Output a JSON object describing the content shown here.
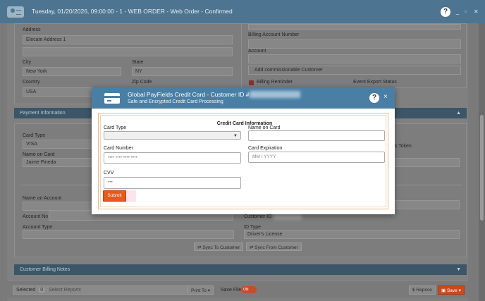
{
  "window": {
    "title": "Tuesday, 01/20/2026, 09:00:00 - 1 - WEB ORDER - Web Order - Confirmed",
    "help_glyph": "?",
    "minimize": "_",
    "maximize": "▫",
    "close": "✕"
  },
  "address_section": {
    "address_label": "Address",
    "address_value": "Elecate Address 1",
    "city_label": "City",
    "city_value": "New York",
    "state_label": "State",
    "state_value": "NY",
    "country_label": "Country",
    "country_value": "USA",
    "zip_label": "Zip Code"
  },
  "billing_section": {
    "billing_account_label": "Billing Account Number",
    "account_label": "Account",
    "commissionable_placeholder": "Add commissionable Customer",
    "billing_reminder_label": "Billing Reminder",
    "event_export_label": "Event Export Status"
  },
  "payment_section": {
    "header": "Payment Information",
    "card_type_label": "Card Type",
    "card_type_value": "VISA",
    "name_on_card_label": "Name on Card",
    "name_on_card_value": "Jaime Pineda",
    "token_text": "d Is Token",
    "name_on_account_label": "Name on Account",
    "account_no_label": "Account No",
    "account_type_label": "Account Type",
    "customer_id_label": "Customer ID",
    "id_type_label": "ID Type",
    "id_type_value": "Driver's License",
    "sync_to_label": "Sync To Customer",
    "sync_from_label": "Sync From Customer"
  },
  "customer_billing_notes": {
    "header": "Customer Billing Notes"
  },
  "bottom_bar": {
    "selected_label": "Selected",
    "selected_count": "0",
    "select_reports_placeholder": "Select Reports",
    "print_to_label": "Print To",
    "save_file_label": "Save File",
    "save_file_toggle": "ON",
    "reprice_label": "Reprice",
    "save_label": "Save"
  },
  "modal": {
    "title": "Global PayFields Credit Card - Customer ID #:",
    "subtitle": "Safe and Encrypted Credit Card Processing",
    "help_glyph": "?",
    "close_glyph": "×",
    "form_title": "Credit Card Information",
    "card_type_label": "Card Type",
    "card_type_value": "",
    "name_on_card_label": "Name on Card",
    "card_number_label": "Card Number",
    "card_number_placeholder": "•••• •••• •••• ••••",
    "card_expiration_label": "Card Expiration",
    "card_expiration_placeholder": "MM / YYYY",
    "cvv_label": "CVV",
    "cvv_placeholder": "•••",
    "submit_label": "Submit"
  },
  "colors": {
    "titlebar": "#4d7591",
    "modal_header": "#4a7fa5",
    "submit": "#e8591a",
    "save": "#c84a1c",
    "section_header": "#3c5567"
  }
}
